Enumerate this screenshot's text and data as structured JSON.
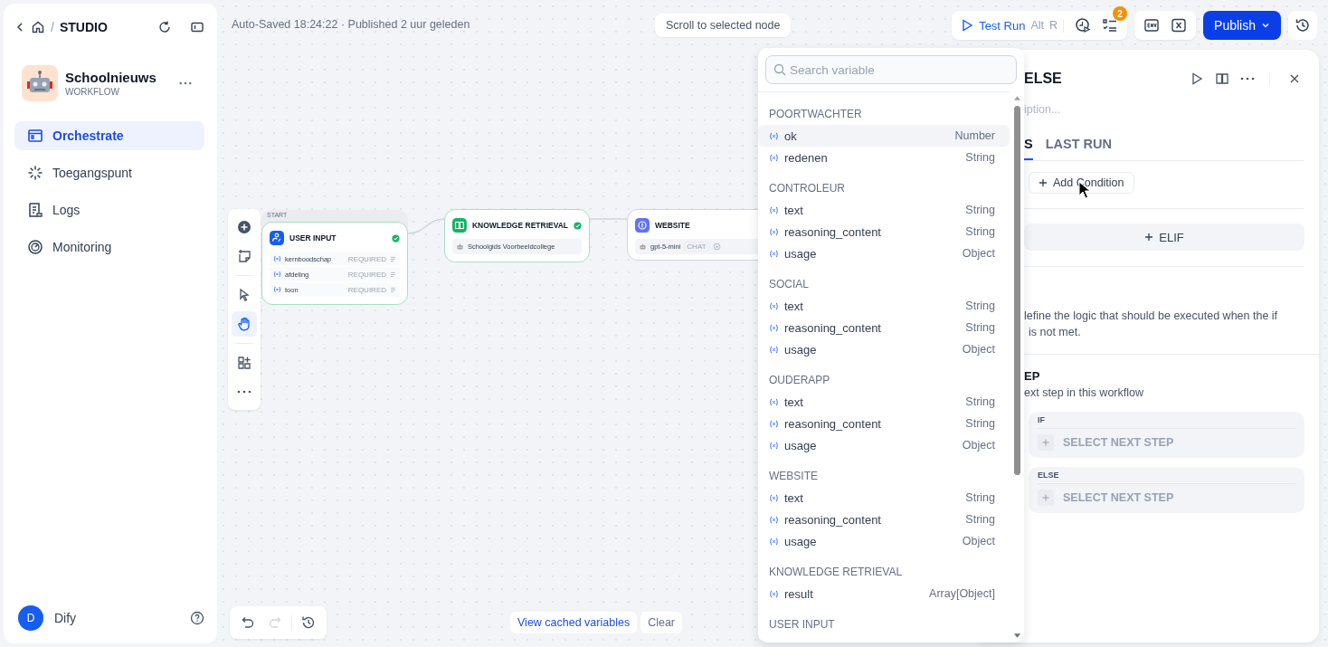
{
  "sidebar": {
    "breadcrumb": {
      "separator": "/",
      "label": "STUDIO"
    },
    "app": {
      "name": "Schoolnieuws",
      "type": "WORKFLOW"
    },
    "nav": [
      {
        "label": "Orchestrate",
        "selected": true
      },
      {
        "label": "Toegangspunt",
        "selected": false
      },
      {
        "label": "Logs",
        "selected": false
      },
      {
        "label": "Monitoring",
        "selected": false
      }
    ],
    "user": {
      "initial": "D",
      "name": "Dify"
    }
  },
  "topbar": {
    "status": "Auto-Saved 18:24:22 · Published 2 uur geleden",
    "scroll_button": "Scroll to selected node",
    "test_run": "Test Run",
    "shortcut": [
      "Alt",
      "R"
    ],
    "badge": "2",
    "publish": "Publish"
  },
  "canvas": {
    "start_label": "START",
    "tools": [
      {
        "selected": false
      },
      {
        "selected": false
      },
      {
        "selected": false
      },
      {
        "selected": true
      },
      {
        "selected": false
      },
      {
        "selected": false
      }
    ],
    "nodes": [
      {
        "kind": "start",
        "title": "USER INPUT",
        "ok": true,
        "fields": [
          {
            "name": "kernboodschap",
            "tag": "REQUIRED"
          },
          {
            "name": "afdeling",
            "tag": "REQUIRED"
          },
          {
            "name": "toon",
            "tag": "REQUIRED"
          }
        ]
      },
      {
        "kind": "knowledge",
        "title": "KNOWLEDGE RETRIEVAL",
        "ok": true,
        "detail": "Schoolgids Voorbeeldcollege"
      },
      {
        "kind": "llm",
        "title": "WEBSITE",
        "ok": false,
        "detail": "gpt-5-mini",
        "mode": "CHAT"
      }
    ],
    "redo_disabled": true,
    "cached": "View cached variables",
    "clear": "Clear"
  },
  "variable_picker": {
    "placeholder": "Search variable",
    "groups": [
      {
        "name": "POORTWACHTER",
        "vars": [
          {
            "name": "ok",
            "type": "Number",
            "selected": true
          },
          {
            "name": "redenen",
            "type": "String",
            "selected": false
          }
        ]
      },
      {
        "name": "CONTROLEUR",
        "vars": [
          {
            "name": "text",
            "type": "String",
            "selected": false
          },
          {
            "name": "reasoning_content",
            "type": "String",
            "selected": false
          },
          {
            "name": "usage",
            "type": "Object",
            "selected": false
          }
        ]
      },
      {
        "name": "SOCIAL",
        "vars": [
          {
            "name": "text",
            "type": "String",
            "selected": false
          },
          {
            "name": "reasoning_content",
            "type": "String",
            "selected": false
          },
          {
            "name": "usage",
            "type": "Object",
            "selected": false
          }
        ]
      },
      {
        "name": "OUDERAPP",
        "vars": [
          {
            "name": "text",
            "type": "String",
            "selected": false
          },
          {
            "name": "reasoning_content",
            "type": "String",
            "selected": false
          },
          {
            "name": "usage",
            "type": "Object",
            "selected": false
          }
        ]
      },
      {
        "name": "WEBSITE",
        "vars": [
          {
            "name": "text",
            "type": "String",
            "selected": false
          },
          {
            "name": "reasoning_content",
            "type": "String",
            "selected": false
          },
          {
            "name": "usage",
            "type": "Object",
            "selected": false
          }
        ]
      },
      {
        "name": "KNOWLEDGE RETRIEVAL",
        "vars": [
          {
            "name": "result",
            "type": "Array[Object]",
            "selected": false
          }
        ]
      },
      {
        "name": "USER INPUT"
      }
    ]
  },
  "panel": {
    "title": "ELSE",
    "description": "iption...",
    "tabs": [
      {
        "label": "S",
        "selected": true
      },
      {
        "label": "LAST RUN",
        "selected": false
      }
    ],
    "add_condition": "Add Condition",
    "elif": "ELIF",
    "else_text": [
      "lefine the logic that should be executed when the if",
      "is not met."
    ],
    "next_step_title": "EP",
    "next_step_text": "ext step in this workflow",
    "branches": [
      {
        "label": "IF",
        "action": "SELECT NEXT STEP"
      },
      {
        "label": "ELSE",
        "action": "SELECT NEXT STEP"
      }
    ]
  }
}
